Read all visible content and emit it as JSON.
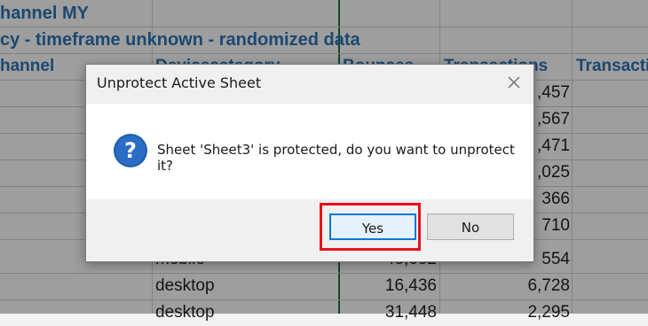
{
  "sheet": {
    "title1": "hannel MY",
    "title2": "cy - timeframe unknown - randomized data",
    "headers": [
      "hannel",
      "Devicecategory",
      "Bounces",
      "Transactions",
      "Transacti"
    ],
    "rows": [
      {
        "device": "",
        "bounces": "",
        "transactions": ",457"
      },
      {
        "device": "",
        "bounces": "",
        "transactions": ",567"
      },
      {
        "device": "",
        "bounces": "",
        "transactions": ",471"
      },
      {
        "device": "",
        "bounces": "",
        "transactions": ",025"
      },
      {
        "device": "",
        "bounces": "",
        "transactions": "366"
      },
      {
        "device": "",
        "bounces": "",
        "transactions": "710"
      },
      {
        "device": "mobile",
        "bounces": "45,652",
        "transactions": "554"
      },
      {
        "device": "desktop",
        "bounces": "16,436",
        "transactions": "6,728"
      },
      {
        "device": "desktop",
        "bounces": "31,448",
        "transactions": "2,295"
      }
    ]
  },
  "dialog": {
    "title": "Unprotect Active Sheet",
    "message": "Sheet 'Sheet3' is protected, do you want to unprotect it?",
    "yes_label": "Yes",
    "no_label": "No",
    "icon": "question-icon",
    "close_icon": "close-icon"
  },
  "colors": {
    "accent": "#0078d7",
    "highlight": "#e8101a",
    "header_text": "#2e75b6"
  }
}
